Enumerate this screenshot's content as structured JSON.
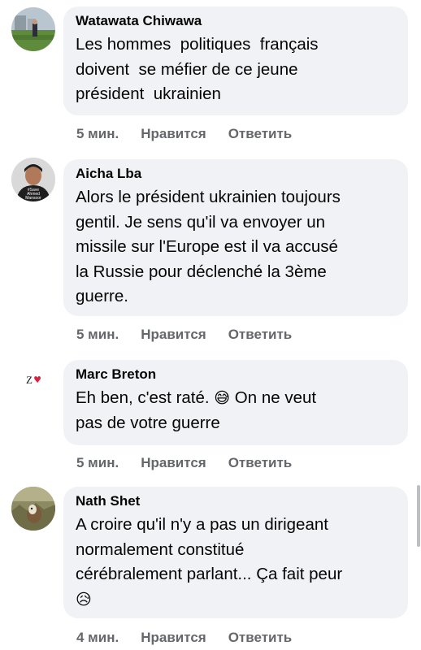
{
  "comments": [
    {
      "author": "Watawata Chiwawa",
      "text": "Les hommes  politiques  français\ndoivent  se méfier de ce jeune\nprésident  ukrainien",
      "time": "5 мин.",
      "like_label": "Нравится",
      "reply_label": "Ответить",
      "avatar_icon": "profile-photo-person-on-field"
    },
    {
      "author": "Aicha Lba",
      "text": "Alors le président ukrainien toujours\ngentil. Je sens qu'il va envoyer un\nmissile sur l'Europe est il va accusé\nla Russie pour déclenché la 3ème\nguerre.",
      "time": "5 мин.",
      "like_label": "Нравится",
      "reply_label": "Ответить",
      "avatar_icon": "profile-photo-man-portrait",
      "avatar_text": [
        "#Save",
        "Ahmed",
        "Mansoor"
      ]
    },
    {
      "author": "Marc Breton",
      "text_before_emoji": "Eh ben, c'est raté. ",
      "emoji": "😅",
      "text_after_emoji": " On ne veut\npas de votre guerre",
      "time": "5 мин.",
      "like_label": "Нравится",
      "reply_label": "Ответить",
      "avatar_icon": "profile-logo-zv-heart",
      "avatar_text": "Z",
      "avatar_heart": "♥"
    },
    {
      "author": "Nath Shet",
      "text": "A croire qu'il n'y a pas un dirigeant\nnormalement constitué\ncérébralement parlant... Ça fait peur\n",
      "emoji": "😥",
      "time": "4 мин.",
      "like_label": "Нравится",
      "reply_label": "Ответить",
      "avatar_icon": "profile-photo-dog-in-grass"
    }
  ],
  "colors": {
    "bubble": "#f0f2f5",
    "text": "#050505",
    "secondary": "#65676b"
  }
}
